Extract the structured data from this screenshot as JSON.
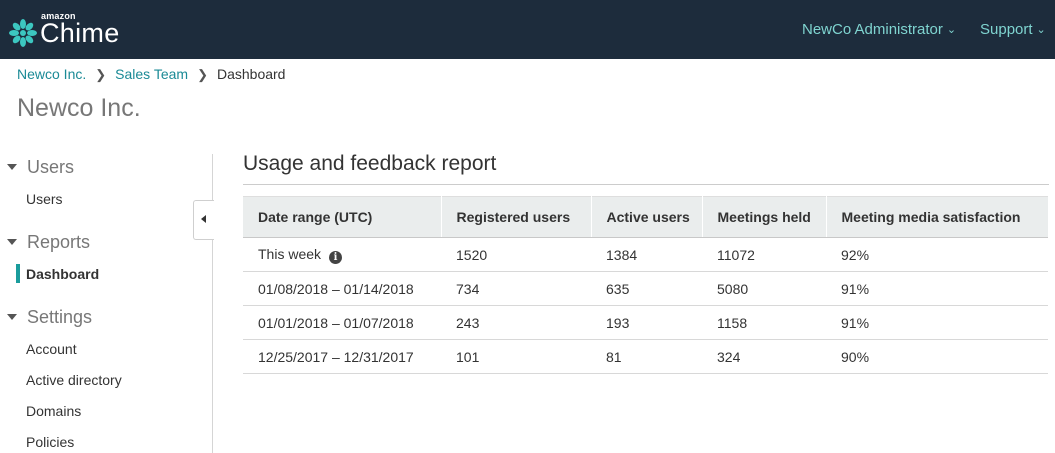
{
  "header": {
    "logo_small": "amazon",
    "logo_big": "Chime",
    "account_menu": "NewCo Administrator",
    "support_menu": "Support"
  },
  "breadcrumb": [
    "Newco Inc.",
    "Sales Team",
    "Dashboard"
  ],
  "page_title": "Newco Inc.",
  "sidebar": {
    "sections": [
      {
        "label": "Users",
        "items": [
          "Users"
        ]
      },
      {
        "label": "Reports",
        "items": [
          "Dashboard"
        ]
      },
      {
        "label": "Settings",
        "items": [
          "Account",
          "Active directory",
          "Domains",
          "Policies"
        ]
      }
    ],
    "active_item": "Dashboard"
  },
  "report": {
    "title": "Usage and feedback report",
    "columns": [
      "Date range (UTC)",
      "Registered users",
      "Active users",
      "Meetings held",
      "Meeting media satisfaction"
    ],
    "rows": [
      [
        "This week",
        "1520",
        "1384",
        "11072",
        "92%"
      ],
      [
        "01/08/2018 – 01/14/2018",
        "734",
        "635",
        "5080",
        "91%"
      ],
      [
        "01/01/2018 – 01/07/2018",
        "243",
        "193",
        "1158",
        "91%"
      ],
      [
        "12/25/2017 – 12/31/2017",
        "101",
        "81",
        "324",
        "90%"
      ]
    ]
  },
  "colors": {
    "topbar": "#1d2c3c",
    "accent": "#1a9c9c",
    "link": "#1a8a96"
  }
}
